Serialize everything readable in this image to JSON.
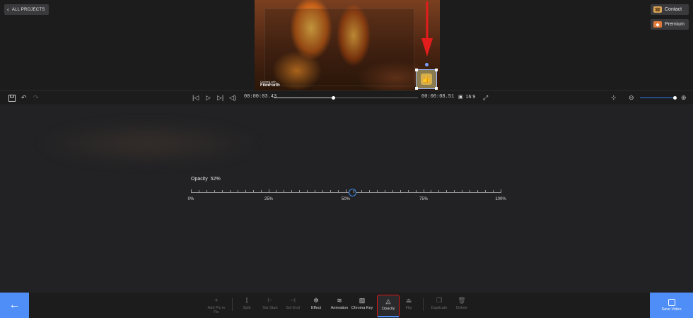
{
  "header": {
    "back_label": "ALL PROJECTS",
    "contact_label": "Contact",
    "premium_label": "Premium"
  },
  "preview": {
    "watermark_small": "Created with",
    "watermark_brand": "FilmForth"
  },
  "player": {
    "current_time": "00:00:03.43",
    "total_time": "00:00:08.51",
    "progress": 0.41,
    "aspect_ratio": "16:9",
    "zoom_level": 0.95
  },
  "opacity": {
    "label": "Opacity",
    "value_text": "52%",
    "value": 52,
    "marks": [
      "0%",
      "25%",
      "50%",
      "75%",
      "100%"
    ]
  },
  "tools": [
    {
      "id": "add-pic-in-pic",
      "label": "Add Pic in Pic",
      "icon": "plus-icon",
      "state": "disabled"
    },
    {
      "id": "split",
      "label": "Split",
      "icon": "split-icon",
      "state": "disabled"
    },
    {
      "id": "set-start",
      "label": "Set Start",
      "icon": "set-start-icon",
      "state": "disabled"
    },
    {
      "id": "set-end",
      "label": "Set End",
      "icon": "set-end-icon",
      "state": "disabled"
    },
    {
      "id": "effect",
      "label": "Effect",
      "icon": "effect-icon",
      "state": "normal"
    },
    {
      "id": "animation",
      "label": "Animation",
      "icon": "animation-icon",
      "state": "normal"
    },
    {
      "id": "chroma-key",
      "label": "Chroma Key",
      "icon": "chroma-key-icon",
      "state": "normal"
    },
    {
      "id": "opacity",
      "label": "Opacity",
      "icon": "opacity-icon",
      "state": "active"
    },
    {
      "id": "flip",
      "label": "Flip",
      "icon": "flip-icon",
      "state": "disabled"
    },
    {
      "id": "duplicate",
      "label": "Duplicate",
      "icon": "duplicate-icon",
      "state": "disabled"
    },
    {
      "id": "delete",
      "label": "Delete",
      "icon": "delete-icon",
      "state": "disabled"
    }
  ],
  "save_label": "Save Video",
  "colors": {
    "accent": "#4f8ef7",
    "highlight": "#e01818",
    "arrow": "#e31c1c"
  }
}
